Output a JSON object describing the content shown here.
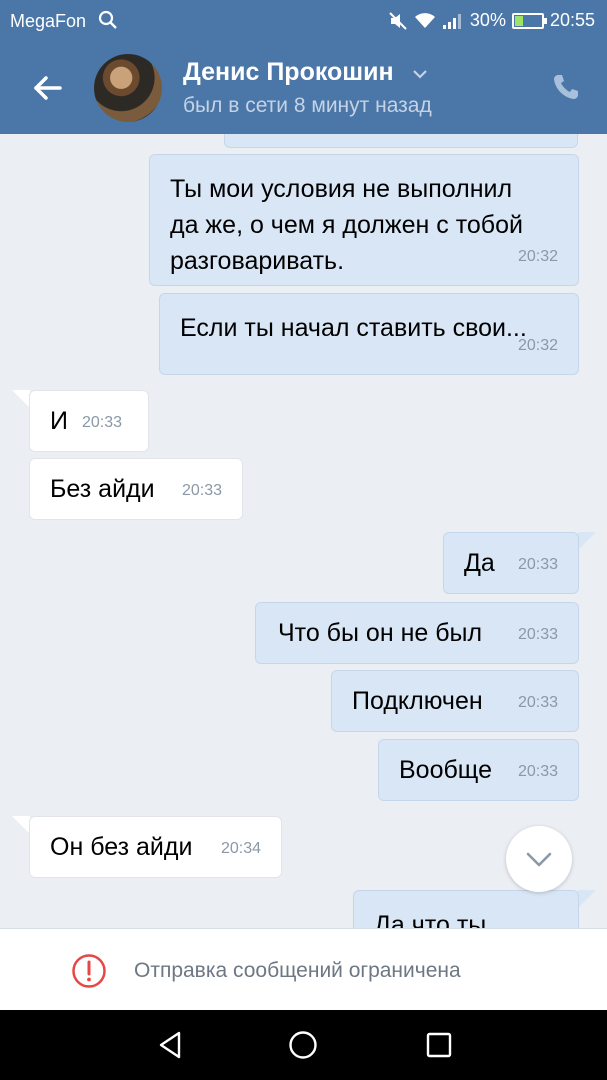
{
  "status_bar": {
    "carrier": "MegaFon",
    "battery_percent": "30%",
    "battery_level": 0.3,
    "time": "20:55"
  },
  "header": {
    "contact_name": "Денис Прокошин",
    "last_seen": "был в сети 8 минут назад"
  },
  "messages": [
    {
      "side": "out",
      "text": "Ты мои условия не выполнил\nда же, о чем  я должен с тобой\nразговаривать.",
      "time": "20:32"
    },
    {
      "side": "out",
      "text": "Если ты начал ставить свои...",
      "time": "20:32"
    },
    {
      "side": "in",
      "text": "И",
      "time": "20:33"
    },
    {
      "side": "in",
      "text": "Без айди",
      "time": "20:33"
    },
    {
      "side": "out",
      "text": "Да",
      "time": "20:33"
    },
    {
      "side": "out",
      "text": "Что бы он не был",
      "time": "20:33"
    },
    {
      "side": "out",
      "text": "Подключен",
      "time": "20:33"
    },
    {
      "side": "out",
      "text": "Вообще",
      "time": "20:33"
    },
    {
      "side": "in",
      "text": "Он без айди",
      "time": "20:34"
    },
    {
      "side": "out",
      "text": "Да что ты",
      "time": ""
    }
  ],
  "restriction": {
    "text": "Отправка сообщений ограничена"
  },
  "colors": {
    "header": "#4a76a8",
    "chat_background": "#ebeff4",
    "outgoing_bubble": "#d9e6f6",
    "incoming_bubble": "#ffffff",
    "warning": "#e64646"
  },
  "icons": {
    "back": "arrow-left-icon",
    "call": "phone-icon",
    "scroll": "chevron-down-icon",
    "warning": "exclamation-circle-icon",
    "nav": [
      "back-triangle-icon",
      "home-circle-icon",
      "recents-square-icon"
    ]
  }
}
